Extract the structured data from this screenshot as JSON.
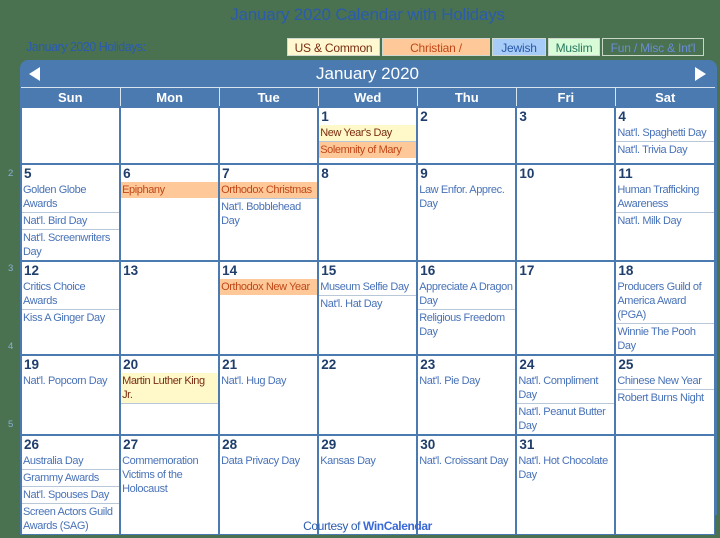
{
  "page": {
    "title": "January 2020 Calendar with Holidays",
    "subtitle": "January 2020 Holidays:",
    "footer_prefix": "Courtesy of ",
    "footer_link": "WinCalendar"
  },
  "legend": [
    {
      "label": "US & Common",
      "category": "us",
      "bg": "#fff8d0",
      "color": "#7a2c10"
    },
    {
      "label": "Christian / Catholic",
      "category": "christian",
      "bg": "#ffc898",
      "color": "#c04818"
    },
    {
      "label": "Jewish",
      "category": "jewish",
      "bg": "#a8ccf8",
      "color": "#2858a8"
    },
    {
      "label": "Muslim",
      "category": "muslim",
      "bg": "#d8fcd8",
      "color": "#287860"
    },
    {
      "label": "Fun / Misc & Int'l",
      "category": "fun",
      "bg": "transparent",
      "color": "#6a8cd8"
    }
  ],
  "calendar": {
    "month_title": "January 2020",
    "prev_icon": "triangle-left",
    "next_icon": "triangle-right",
    "weekdays": [
      "Sun",
      "Mon",
      "Tue",
      "Wed",
      "Thu",
      "Fri",
      "Sat"
    ],
    "week_numbers": [
      "2",
      "3",
      "4",
      "5"
    ],
    "weeks": [
      [
        {
          "day": "",
          "events": []
        },
        {
          "day": "",
          "events": []
        },
        {
          "day": "",
          "events": []
        },
        {
          "day": "1",
          "events": [
            {
              "name": "New Year's Day",
              "type": "us"
            },
            {
              "name": "Solemnity of Mary",
              "type": "chr"
            }
          ]
        },
        {
          "day": "2",
          "events": []
        },
        {
          "day": "3",
          "events": []
        },
        {
          "day": "4",
          "events": [
            {
              "name": "Nat'l. Spaghetti Day",
              "type": "fun"
            },
            {
              "name": "Nat'l. Trivia Day",
              "type": "fun"
            }
          ]
        }
      ],
      [
        {
          "day": "5",
          "events": [
            {
              "name": "Golden Globe Awards",
              "type": "fun"
            },
            {
              "name": "Nat'l. Bird Day",
              "type": "fun"
            },
            {
              "name": "Nat'l. Screenwriters Day",
              "type": "fun"
            }
          ]
        },
        {
          "day": "6",
          "events": [
            {
              "name": "Epiphany",
              "type": "chr"
            }
          ]
        },
        {
          "day": "7",
          "events": [
            {
              "name": "Orthodox Christmas",
              "type": "chr"
            },
            {
              "name": "Nat'l. Bobblehead Day",
              "type": "fun"
            }
          ]
        },
        {
          "day": "8",
          "events": []
        },
        {
          "day": "9",
          "events": [
            {
              "name": "Law Enfor. Apprec. Day",
              "type": "fun"
            }
          ]
        },
        {
          "day": "10",
          "events": []
        },
        {
          "day": "11",
          "events": [
            {
              "name": "Human Trafficking Awareness",
              "type": "fun"
            },
            {
              "name": "Nat'l. Milk Day",
              "type": "fun"
            }
          ]
        }
      ],
      [
        {
          "day": "12",
          "events": [
            {
              "name": "Critics Choice Awards",
              "type": "fun"
            },
            {
              "name": "Kiss A Ginger Day",
              "type": "fun"
            }
          ]
        },
        {
          "day": "13",
          "events": []
        },
        {
          "day": "14",
          "events": [
            {
              "name": "Orthodox New Year",
              "type": "chr"
            }
          ]
        },
        {
          "day": "15",
          "events": [
            {
              "name": "Museum Selfie Day",
              "type": "fun"
            },
            {
              "name": "Nat'l. Hat Day",
              "type": "fun"
            }
          ]
        },
        {
          "day": "16",
          "events": [
            {
              "name": "Appreciate A Dragon Day",
              "type": "fun"
            },
            {
              "name": "Religious Freedom Day",
              "type": "fun"
            }
          ]
        },
        {
          "day": "17",
          "events": []
        },
        {
          "day": "18",
          "events": [
            {
              "name": "Producers Guild of America Award (PGA)",
              "type": "fun"
            },
            {
              "name": "Winnie The Pooh Day",
              "type": "fun"
            }
          ]
        }
      ],
      [
        {
          "day": "19",
          "events": [
            {
              "name": "Nat'l. Popcorn Day",
              "type": "fun"
            }
          ]
        },
        {
          "day": "20",
          "events": [
            {
              "name": "Martin Luther King Jr.",
              "type": "us"
            }
          ]
        },
        {
          "day": "21",
          "events": [
            {
              "name": "Nat'l. Hug Day",
              "type": "fun"
            }
          ]
        },
        {
          "day": "22",
          "events": []
        },
        {
          "day": "23",
          "events": [
            {
              "name": "Nat'l. Pie Day",
              "type": "fun"
            }
          ]
        },
        {
          "day": "24",
          "events": [
            {
              "name": "Nat'l. Compliment Day",
              "type": "fun"
            },
            {
              "name": "Nat'l. Peanut Butter Day",
              "type": "fun"
            }
          ]
        },
        {
          "day": "25",
          "events": [
            {
              "name": "Chinese New Year",
              "type": "fun"
            },
            {
              "name": "Robert Burns Night",
              "type": "fun"
            }
          ]
        }
      ],
      [
        {
          "day": "26",
          "events": [
            {
              "name": "Australia Day",
              "type": "fun"
            },
            {
              "name": "Grammy Awards",
              "type": "fun"
            },
            {
              "name": "Nat'l. Spouses Day",
              "type": "fun"
            },
            {
              "name": "Screen Actors Guild Awards (SAG)",
              "type": "fun"
            }
          ]
        },
        {
          "day": "27",
          "events": [
            {
              "name": "Commemoration Victims of the Holocaust",
              "type": "fun"
            }
          ]
        },
        {
          "day": "28",
          "events": [
            {
              "name": "Data Privacy Day",
              "type": "fun"
            }
          ]
        },
        {
          "day": "29",
          "events": [
            {
              "name": "Kansas Day",
              "type": "fun"
            }
          ]
        },
        {
          "day": "30",
          "events": [
            {
              "name": "Nat'l. Croissant Day",
              "type": "fun"
            }
          ]
        },
        {
          "day": "31",
          "events": [
            {
              "name": "Nat'l. Hot Chocolate Day",
              "type": "fun"
            }
          ]
        },
        {
          "day": "",
          "events": []
        }
      ]
    ]
  }
}
